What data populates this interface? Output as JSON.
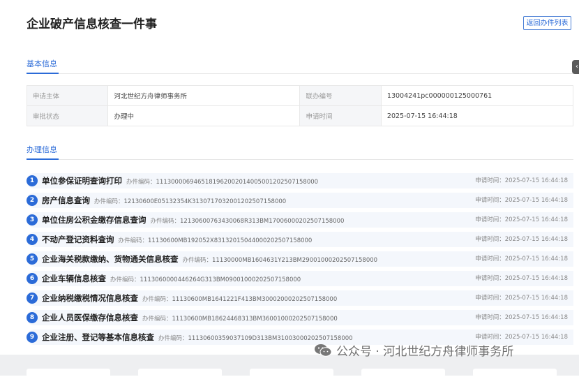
{
  "header": {
    "title": "企业破产信息核查一件事",
    "back_button": "返回办件列表"
  },
  "basic_info": {
    "section_title": "基本信息",
    "rows": [
      [
        {
          "label": "申请主体",
          "value": "河北世纪方舟律师事务所"
        },
        {
          "label": "联办编号",
          "value": "13004241pc000000125000761"
        }
      ],
      [
        {
          "label": "审批状态",
          "value": "办理中"
        },
        {
          "label": "申请时间",
          "value": "2025-07-15 16:44:18"
        }
      ]
    ]
  },
  "processing": {
    "section_title": "办理信息",
    "code_label": "办件编码：",
    "time_label": "申请时间：",
    "items": [
      {
        "num": "1",
        "name": "单位参保证明查询打印",
        "code": "11130000694651819620020140050012025071580​00",
        "time": "2025-07-15 16:44:18"
      },
      {
        "num": "2",
        "name": "房产信息查询",
        "code": "12130600E05132354K31307170320012025071580​00",
        "time": "2025-07-15 16:44:18"
      },
      {
        "num": "3",
        "name": "单位住房公积金缴存信息查询",
        "code": "12130600763430068R313BM17006000202507158000",
        "time": "2025-07-15 16:44:18"
      },
      {
        "num": "4",
        "name": "不动产登记资料查询",
        "code": "11130600MB192052X83132015044000202507158000",
        "time": "2025-07-15 16:44:18"
      },
      {
        "num": "5",
        "name": "企业海关税款缴纳、货物通关信息核查",
        "code": "11130000MB1604631Y213BM29001000202507158000",
        "time": "2025-07-15 16:44:18"
      },
      {
        "num": "6",
        "name": "企业车辆信息核查",
        "code": "111306000044626​4G313BM0900100020250715​8000",
        "time": "2025-07-15 16:44:18"
      },
      {
        "num": "7",
        "name": "企业纳税缴税情况信息核查",
        "code": "11130600MB1641221F413BM30002000202507158000",
        "time": "2025-07-15 16:44:18"
      },
      {
        "num": "8",
        "name": "企业人员医保缴存信息核查",
        "code": "11130600MB18624468313BM36001000202507158000",
        "time": "2025-07-15 16:44:18"
      },
      {
        "num": "9",
        "name": "企业注册、登记等基本信息核查",
        "code": "11130600359037109D313BM31003000202507158000",
        "time": "2025-07-15 16:44:18"
      }
    ]
  },
  "watermark": "公众号 · 河北世纪方舟律师事务所",
  "colors": {
    "accent": "#2b6bd8",
    "row_bg": "#f4f7fc",
    "label_bg": "#f5f6f8"
  }
}
